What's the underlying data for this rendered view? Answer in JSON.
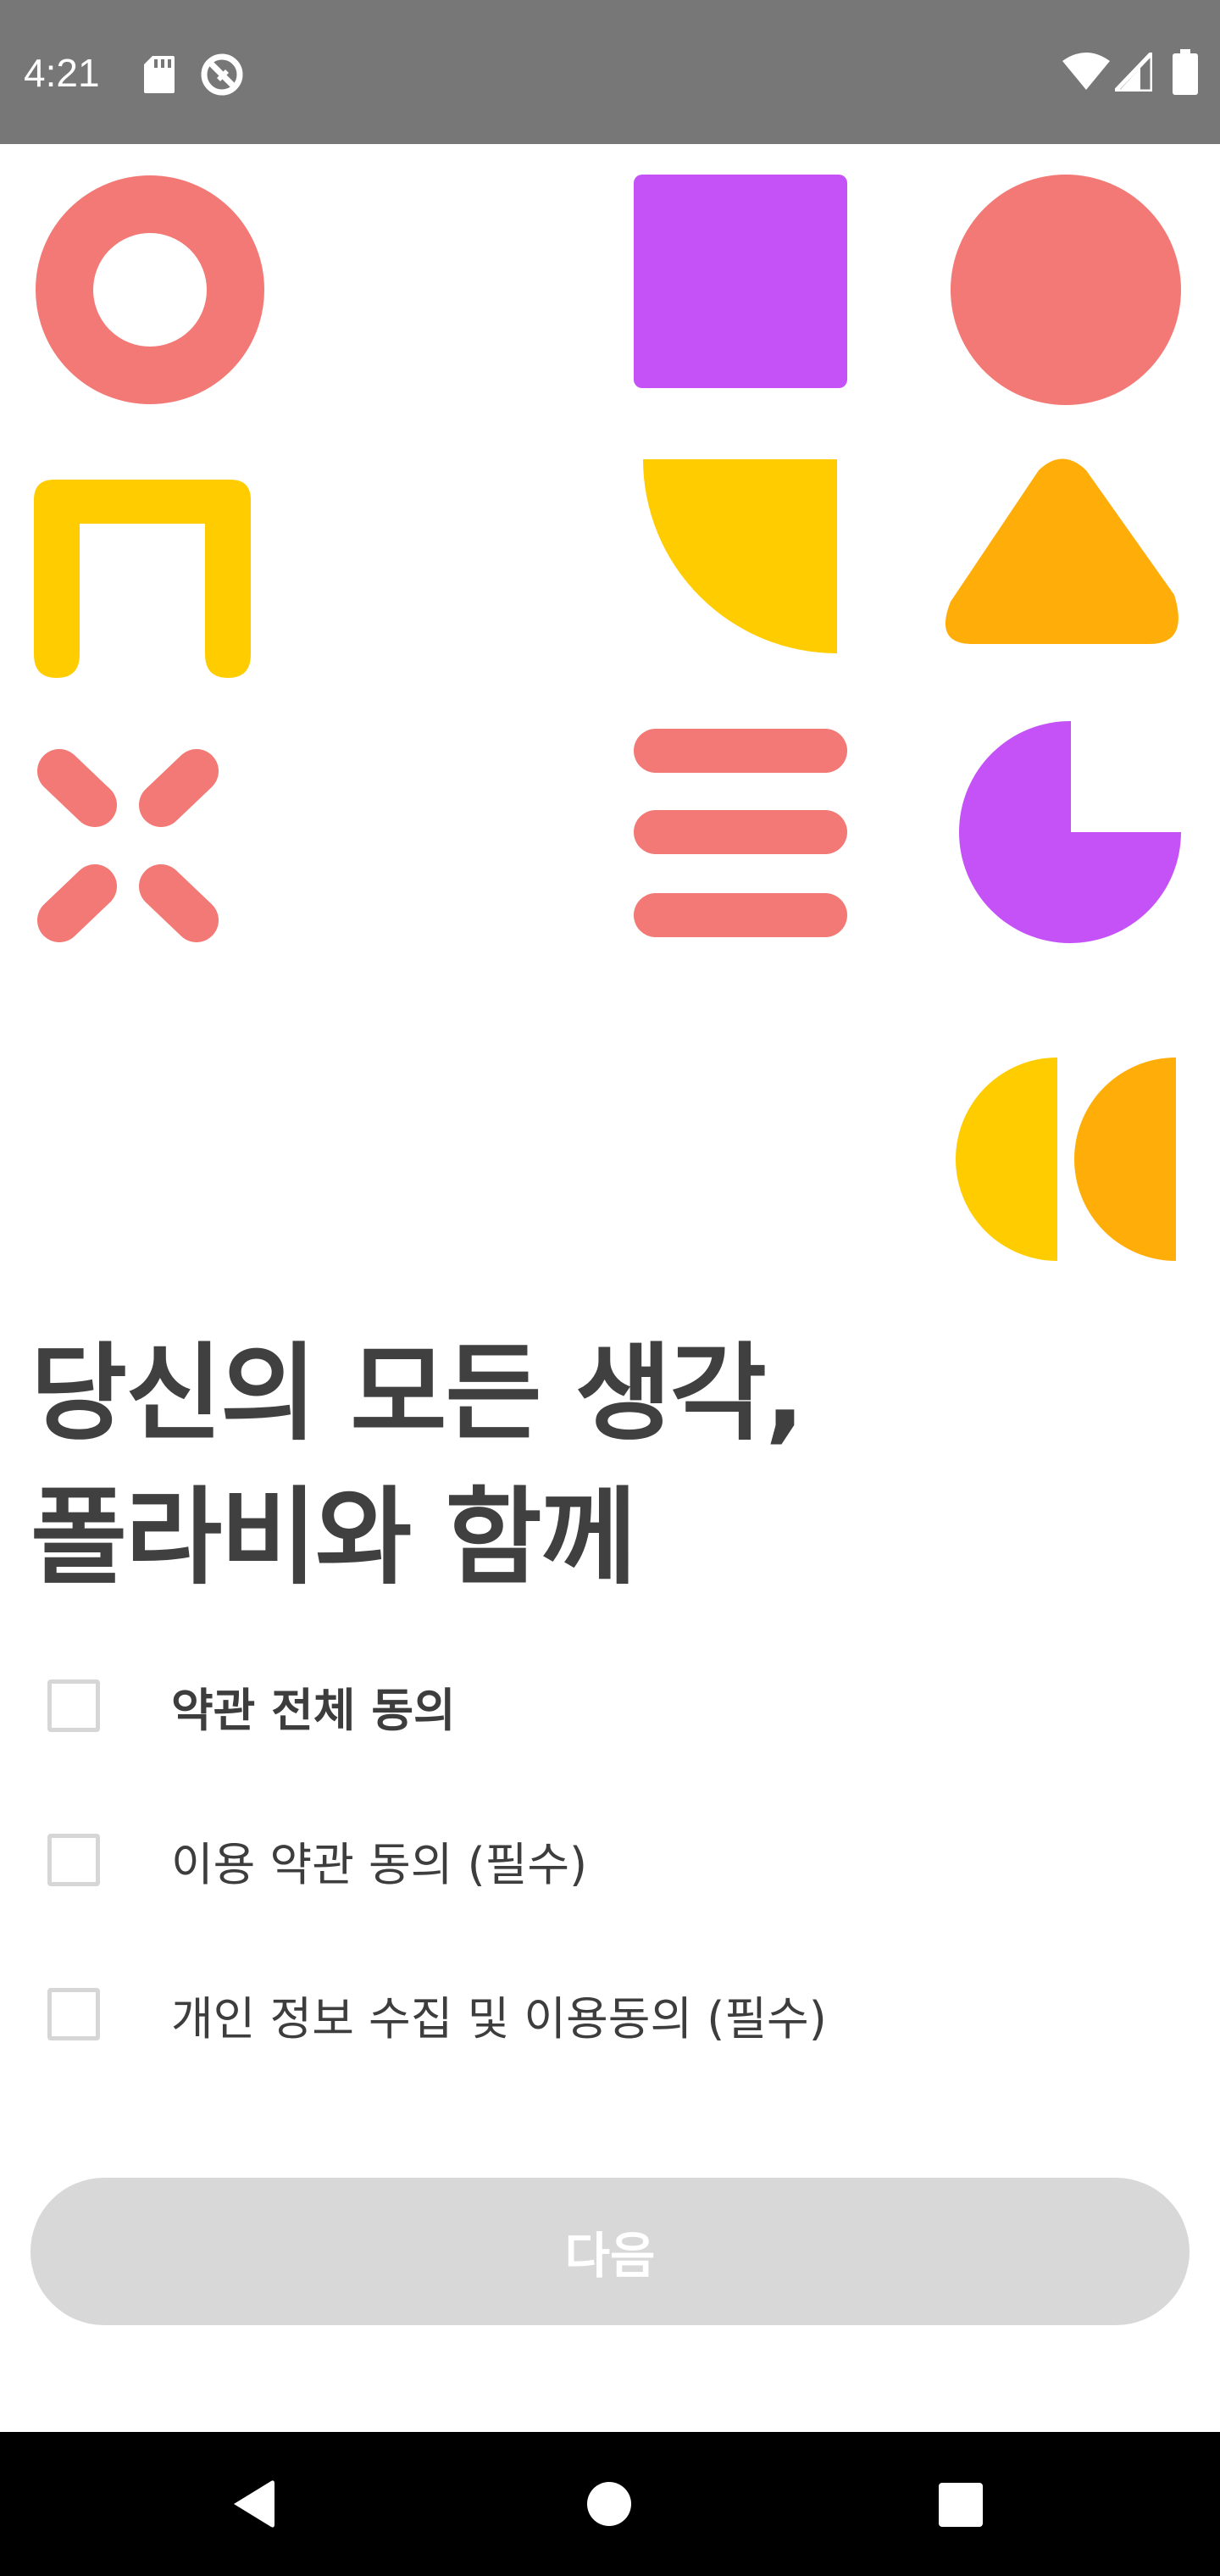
{
  "status_bar": {
    "time": "4:21",
    "left_icons": [
      "sd-card-icon",
      "no-disturb-icon"
    ],
    "right_icons": [
      "wifi-icon",
      "cell-signal-icon",
      "battery-icon"
    ]
  },
  "illustration": {
    "colors": {
      "coral": "#F27975",
      "purple": "#C452F7",
      "yellow": "#FFCC00",
      "orange": "#FFAD08"
    },
    "shapes": [
      "ring",
      "square",
      "circle",
      "arch",
      "quarter-circle",
      "triangle",
      "x-mark",
      "three-bars",
      "pie",
      "half-circle",
      "half-circle"
    ]
  },
  "headline": {
    "line1": "당신의 모든 생각,",
    "line2": "폴라비와 함께"
  },
  "agreements": {
    "all": {
      "label": "약관 전체 동의",
      "checked": false
    },
    "terms": {
      "label": "이용 약관 동의 (필수)",
      "checked": false
    },
    "privacy": {
      "label": "개인 정보 수집 및 이용동의 (필수)",
      "checked": false
    }
  },
  "next_button": {
    "label": "다음",
    "enabled": false
  },
  "nav_bar": {
    "buttons": [
      "back-icon",
      "home-icon",
      "recents-icon"
    ]
  },
  "theme": {
    "status_bar_bg": "#777777",
    "text_dark": "#404040",
    "checkbox_border": "#D6D6D6",
    "button_disabled_bg": "#D8D8D8",
    "nav_bar_bg": "#000000"
  }
}
